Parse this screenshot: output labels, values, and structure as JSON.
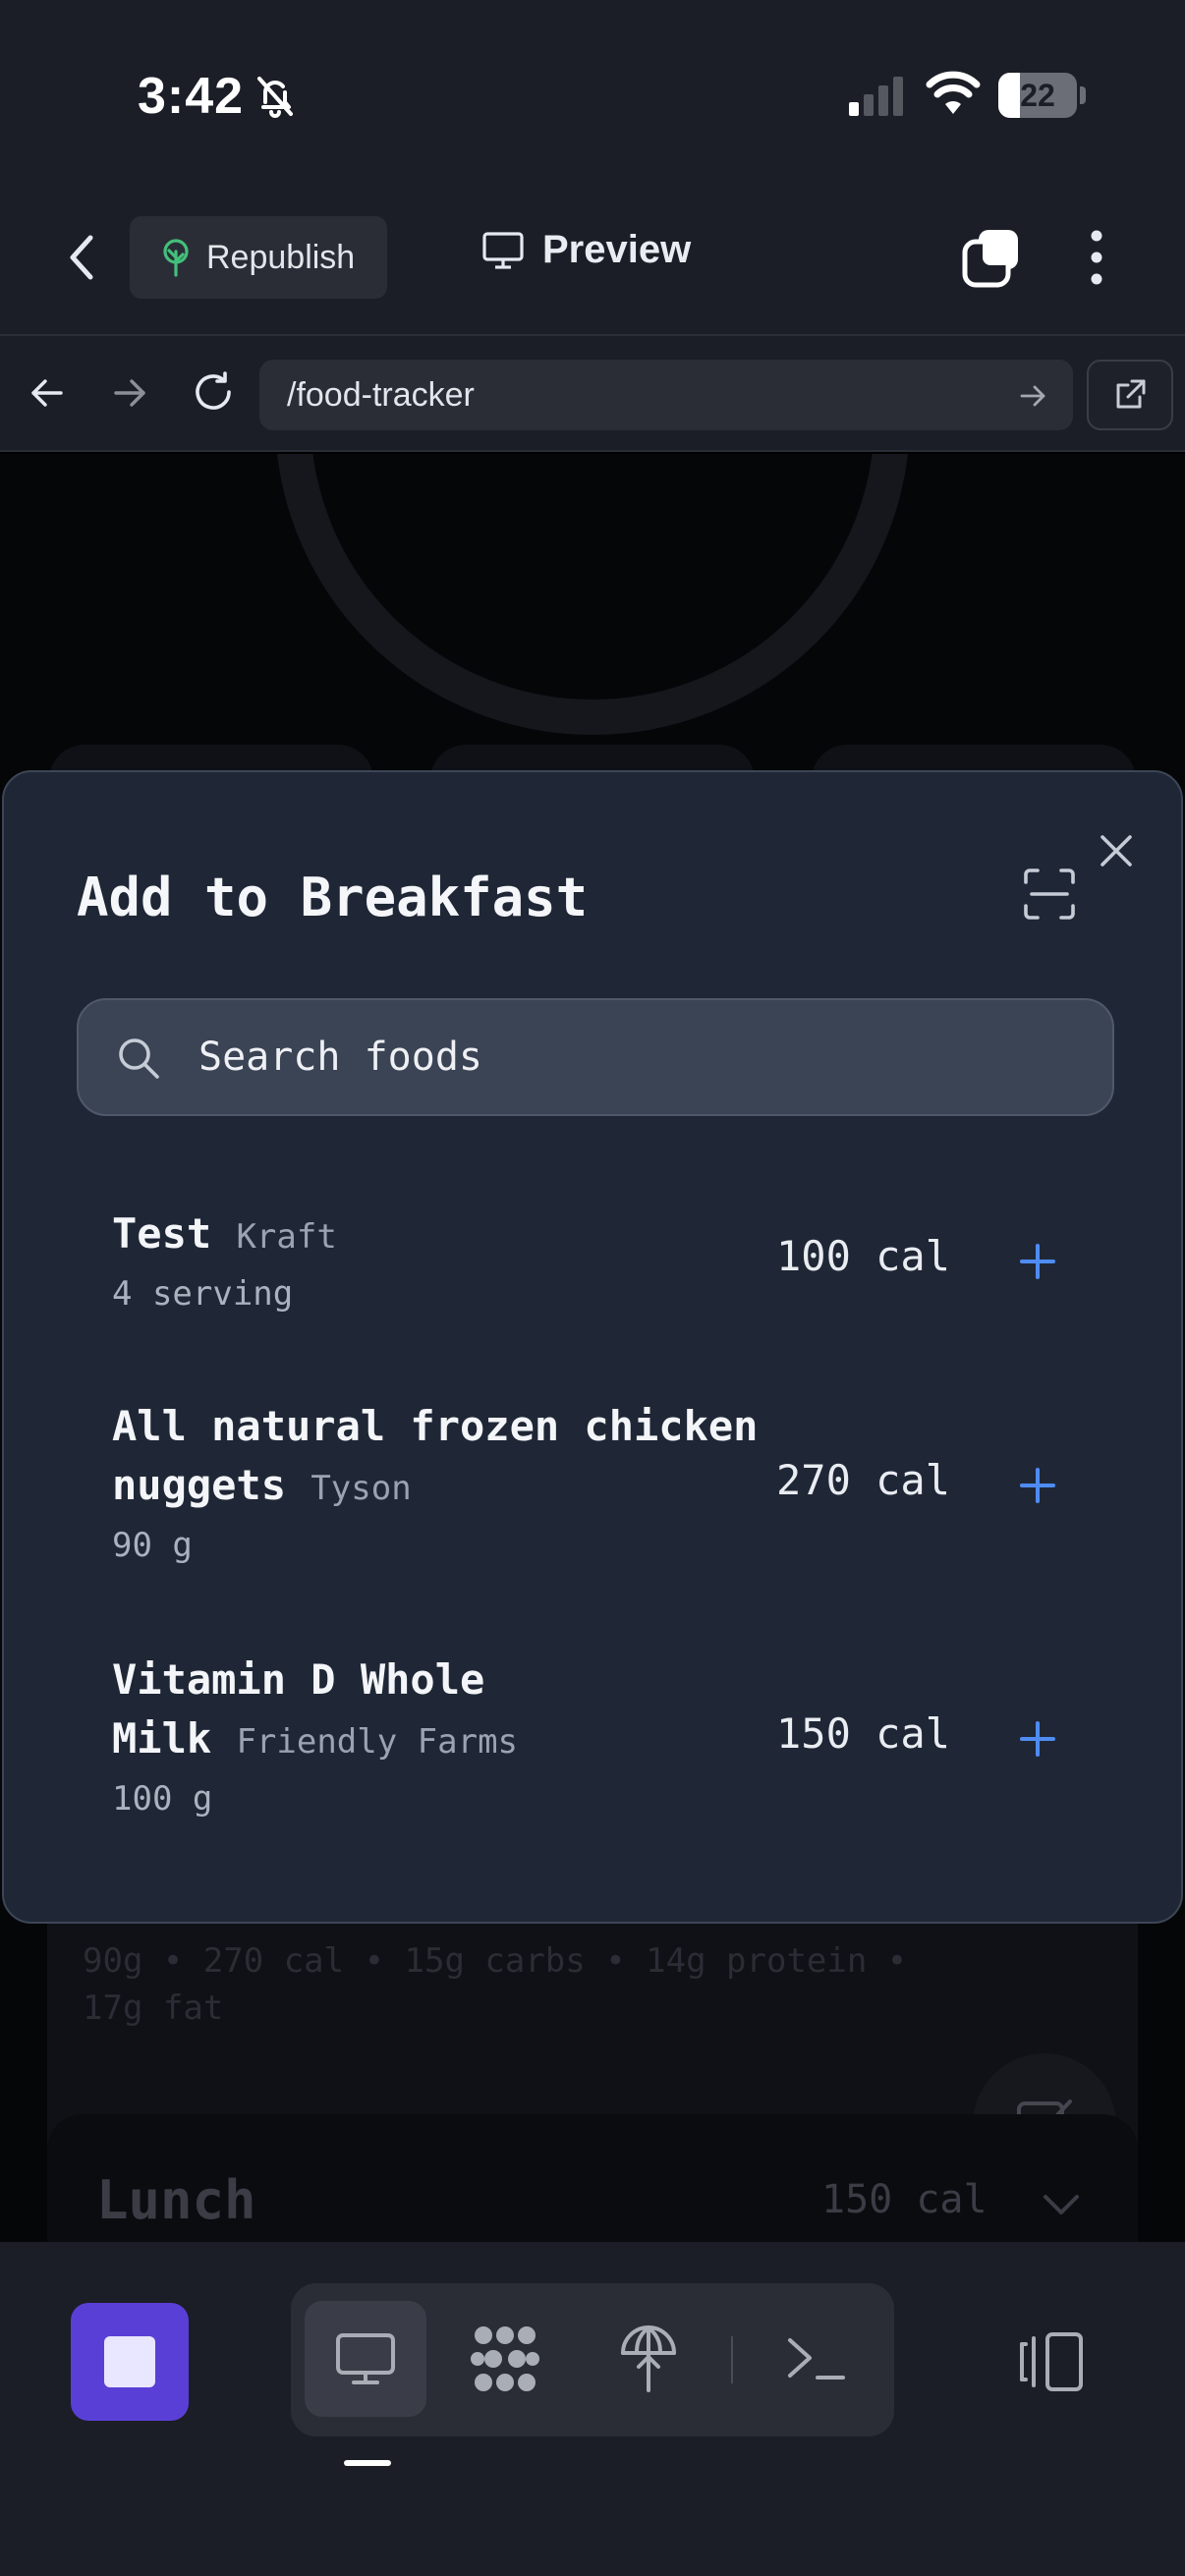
{
  "status_bar": {
    "time": "3:42",
    "battery": "22",
    "battery_level": 0.22
  },
  "header": {
    "republish_label": "Republish",
    "preview_label": "Preview"
  },
  "browser": {
    "url": "/food-tracker"
  },
  "modal": {
    "title": "Add to Breakfast",
    "search_placeholder": "Search foods",
    "items": [
      {
        "name": "Test",
        "brand": "Kraft",
        "serving": "4 serving",
        "calories": "100 cal"
      },
      {
        "name": "All natural frozen chicken nuggets",
        "brand": "Tyson",
        "serving": "90 g",
        "calories": "270 cal"
      },
      {
        "name": "Vitamin D Whole Milk",
        "brand": "Friendly Farms",
        "serving": "100 g",
        "calories": "150 cal"
      }
    ]
  },
  "background": {
    "detail_text": "90g • 270 cal • 15g carbs • 14g protein • 17g fat",
    "lunch_label": "Lunch",
    "lunch_calories": "150 cal"
  },
  "colors": {
    "accent": "#5a3fd6",
    "add_icon": "#4f8cf2",
    "sheet": "#1f2736"
  },
  "icons": [
    "bell-slash-icon",
    "signal-icon",
    "wifi-icon",
    "back-icon",
    "tree-icon",
    "monitor-icon",
    "tabs-icon",
    "more-icon",
    "arrow-left-icon",
    "arrow-right-icon",
    "reload-icon",
    "external-link-icon",
    "close-icon",
    "scan-icon",
    "search-icon",
    "plus-icon",
    "check-icon",
    "chevron-down-icon",
    "stop-icon",
    "grid-icon",
    "globe-icon",
    "terminal-icon",
    "split-view-icon"
  ]
}
